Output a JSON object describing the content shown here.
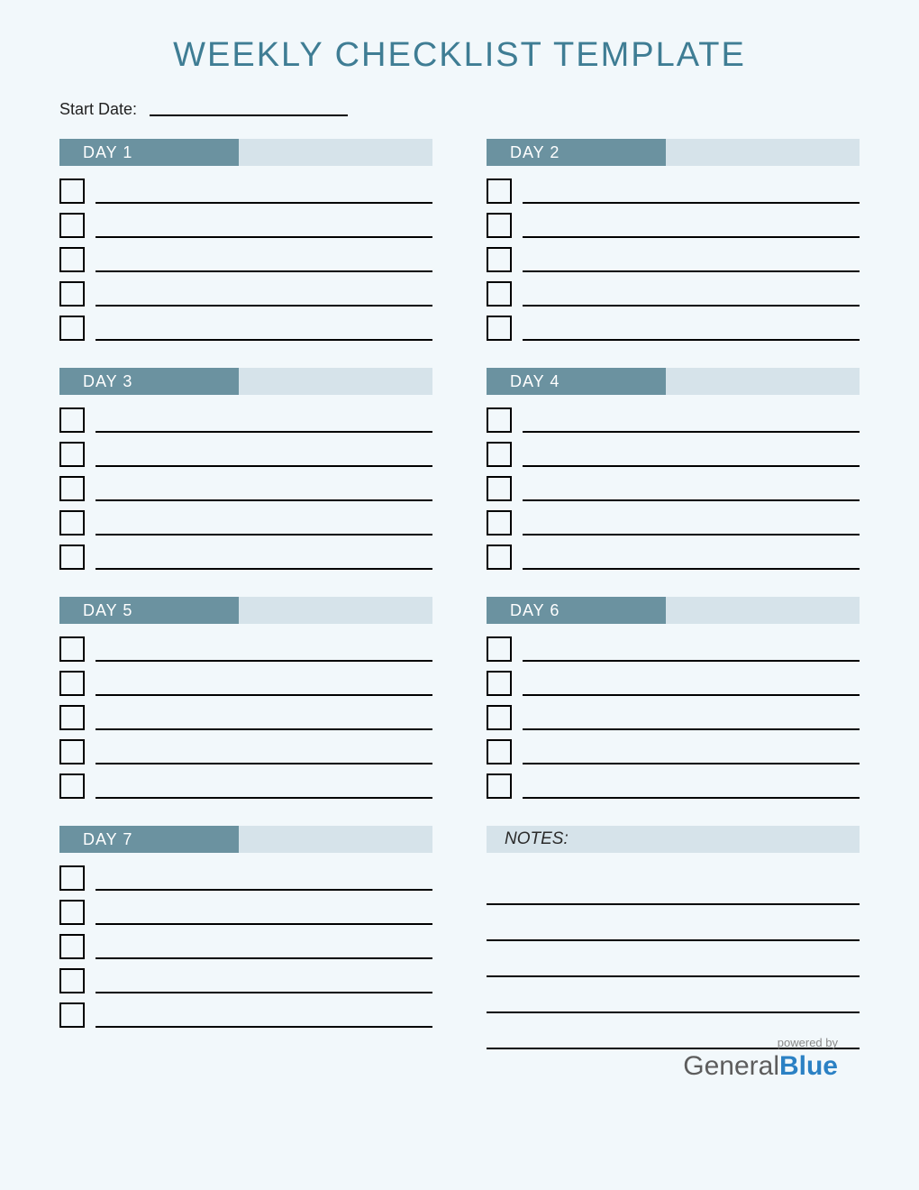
{
  "title": "WEEKLY CHECKLIST TEMPLATE",
  "start_date_label": "Start Date:",
  "days": [
    {
      "label": "DAY 1"
    },
    {
      "label": "DAY 2"
    },
    {
      "label": "DAY 3"
    },
    {
      "label": "DAY 4"
    },
    {
      "label": "DAY 5"
    },
    {
      "label": "DAY 6"
    },
    {
      "label": "DAY 7"
    }
  ],
  "notes_label": "NOTES:",
  "rows_per_day": 5,
  "notes_lines": 5,
  "footer": {
    "powered_by": "powered by",
    "brand_general": "General",
    "brand_blue": "Blue"
  }
}
